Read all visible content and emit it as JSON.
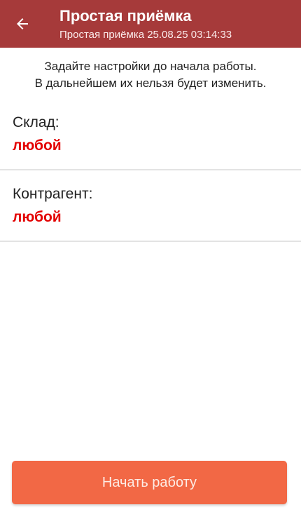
{
  "app_bar": {
    "title": "Простая приёмка",
    "subtitle": "Простая приёмка 25.08.25 03:14:33",
    "back_icon": "arrow-left-icon",
    "color": "#a63a3a"
  },
  "intro": {
    "line1": "Задайте настройки до начала работы.",
    "line2": "В дальнейшем их нельзя будет изменить."
  },
  "settings": [
    {
      "label": "Склад:",
      "value": "любой"
    },
    {
      "label": "Контрагент:",
      "value": "любой"
    }
  ],
  "value_color": "#e30000",
  "start_button": {
    "label": "Начать работу",
    "color": "#f26845"
  }
}
